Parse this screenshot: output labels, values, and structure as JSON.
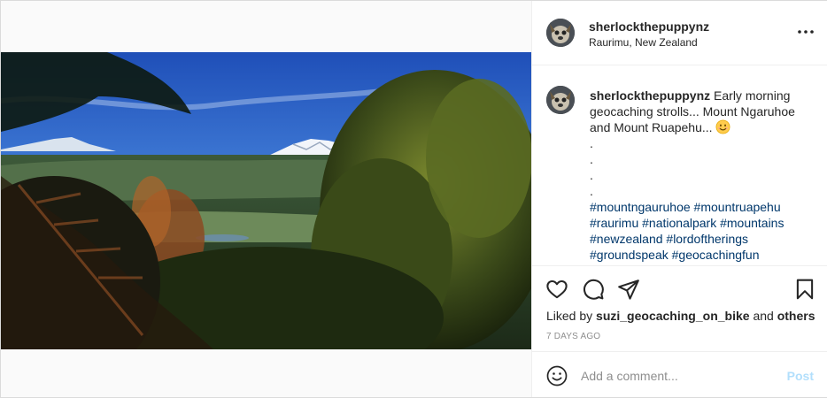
{
  "post": {
    "username": "sherlockthepuppynz",
    "location": "Raurimu, New Zealand",
    "more_icon": "more-horizontal-icon",
    "caption": {
      "username": "sherlockthepuppynz",
      "text": "Early morning geocaching strolls... Mount Ngaruhoe and Mount Ruapehu...",
      "emoji": "smiling-face-icon",
      "dots": [
        ".",
        ".",
        ".",
        "."
      ],
      "hashtags": [
        "#mountngauruhoe",
        "#mountruapehu",
        "#raurimu",
        "#nationalpark",
        "#mountains",
        "#newzealand",
        "#lordoftherings",
        "#groundspeak",
        "#geocachingfun"
      ]
    },
    "actions": {
      "like_icon": "heart-icon",
      "comment_icon": "comment-icon",
      "share_icon": "paper-plane-icon",
      "save_icon": "bookmark-icon"
    },
    "liked_by": {
      "prefix": "Liked by",
      "user": "suzi_geocaching_on_bike",
      "conjunction": "and",
      "others": "others"
    },
    "timestamp": "7 DAYS AGO",
    "comment": {
      "placeholder": "Add a comment...",
      "post_label": "Post",
      "emoji_icon": "emoji-smile-icon"
    },
    "colors": {
      "link": "#00376b",
      "muted": "#8e8e8e",
      "post_disabled": "#b2dffc",
      "border": "#dbdbdb"
    }
  }
}
